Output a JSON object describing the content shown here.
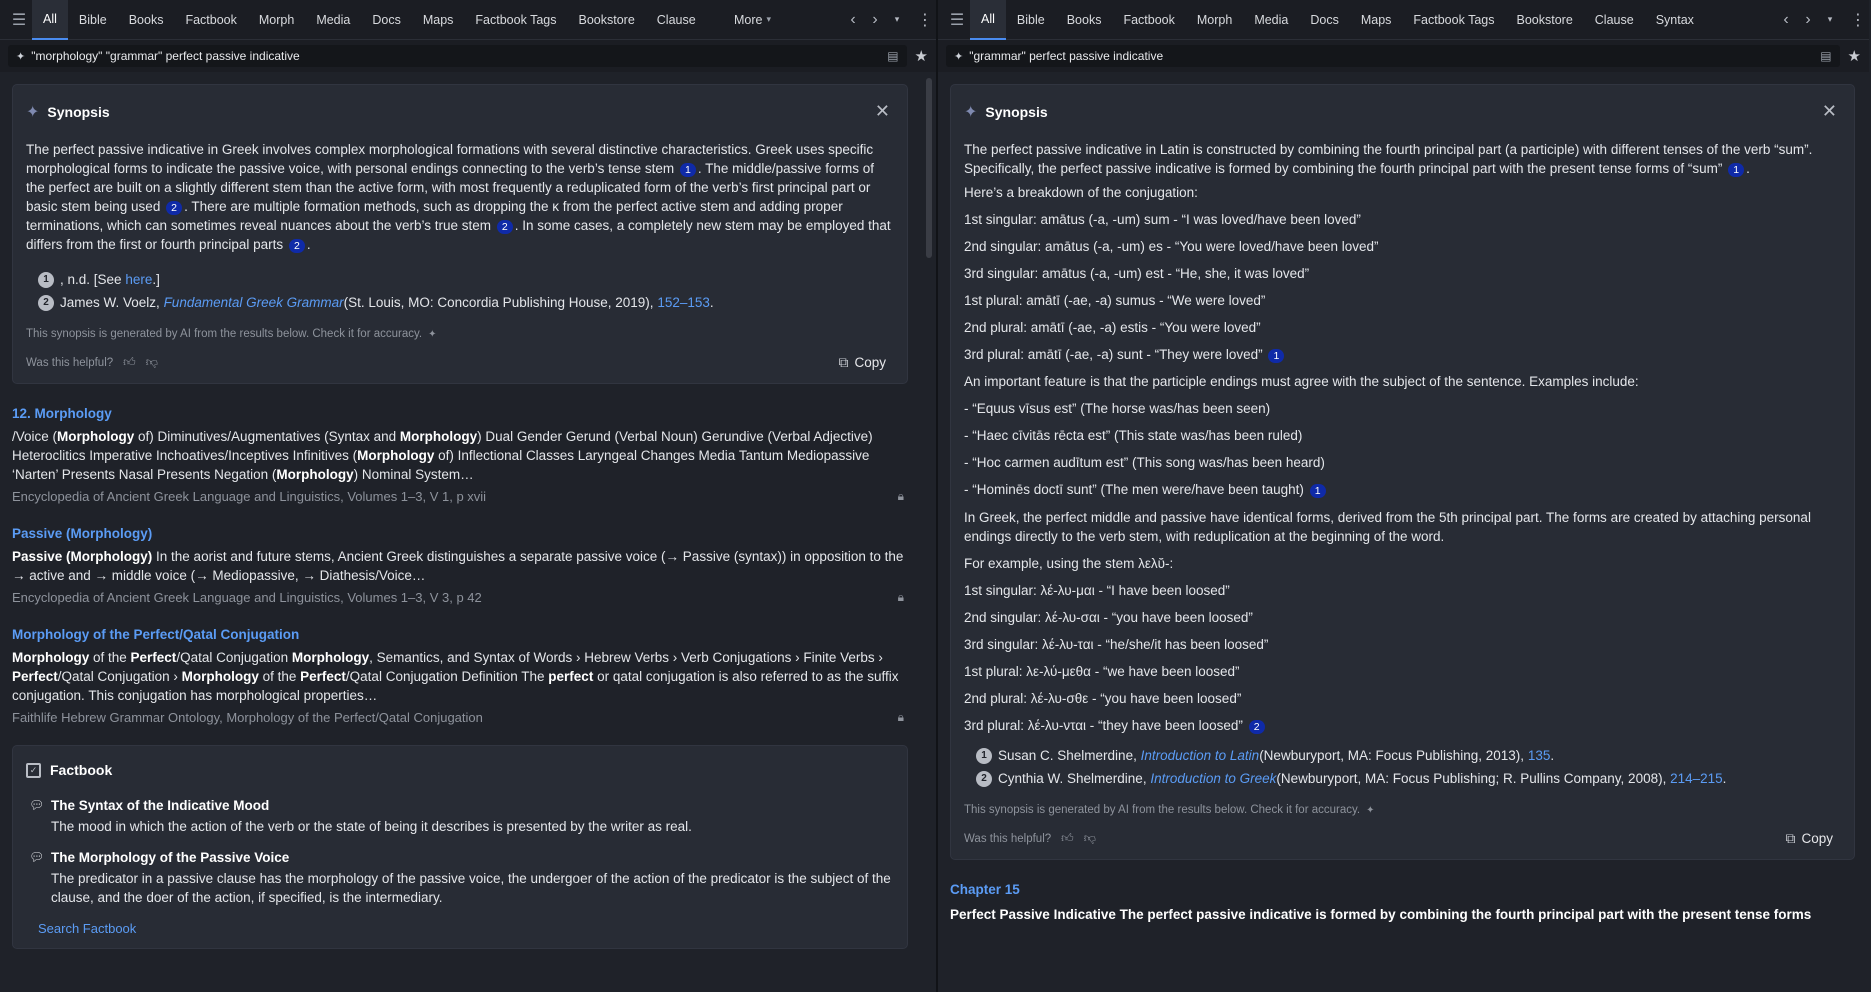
{
  "left": {
    "tabs": [
      "All",
      "Bible",
      "Books",
      "Factbook",
      "Morph",
      "Media",
      "Docs",
      "Maps",
      "Factbook Tags",
      "Bookstore",
      "Clause"
    ],
    "more_label": "More",
    "search_query": "\"morphology\" \"grammar\" perfect passive indicative",
    "synopsis": {
      "title": "Synopsis",
      "p1_a": "The perfect passive indicative in Greek involves complex morphological formations with several distinctive characteristics. Greek uses specific morphological forms to indicate the passive voice, with personal endings connecting to the verb’s tense stem",
      "p1_b": ". The middle/passive forms of the perfect are built on a slightly different stem than the active form, with most frequently a reduplicated form of the verb’s first principal part or basic stem being used",
      "p1_c": ". There are multiple formation methods, such as dropping the κ from the perfect active stem and adding proper terminations, which can sometimes reveal nuances about the verb’s true stem",
      "p1_d": ". In some cases, a completely new stem may be employed that differs from the first or fourth principal parts",
      "p1_e": ".",
      "cite1": "1",
      "cite2": "2",
      "foot1_num": "1",
      "foot1_pre": ", n.d. [See ",
      "foot1_link": "here",
      "foot1_post": ".]",
      "foot2_num": "2",
      "foot2_author": "James W. Voelz, ",
      "foot2_title": "Fundamental Greek Grammar",
      "foot2_pub": " (St. Louis, MO: Concordia Publishing House, 2019), ",
      "foot2_pages": "152–153",
      "foot2_end": ".",
      "disclaimer": "This synopsis is generated by AI from the results below. Check it for accuracy.",
      "helpful": "Was this helpful?",
      "copy": "Copy"
    },
    "results": [
      {
        "title": "12. Morphology",
        "body_html_parts": [
          "/Voice (",
          "Morphology",
          " of) Diminutives/Augmentatives (Syntax and ",
          "Morphology",
          ") Dual Gender Gerund (Verbal Noun) Gerundive (Verbal Adjective) Heteroclitics Imperative Inchoatives/Inceptives Infinitives (",
          "Morphology",
          " of) Inflectional Classes Laryngeal Changes Media Tantum Mediopassive ‘Narten’ Presents Nasal Presents Negation (",
          "Morphology",
          ") Nominal System…"
        ],
        "meta": "Encyclopedia of Ancient Greek Language and Linguistics, Volumes 1–3, V 1, p xvii"
      },
      {
        "title": "Passive (Morphology)",
        "body_html_parts": [
          "",
          "Passive (Morphology)",
          " In the aorist and future stems, Ancient Greek distinguishes a separate passive voice (→ Passive (syntax)) in opposition to the → active and → middle voice (→ Mediopassive, → Diathesis/Voice…"
        ],
        "meta": "Encyclopedia of Ancient Greek Language and Linguistics, Volumes 1–3, V 3, p 42"
      },
      {
        "title": "Morphology of the Perfect/Qatal Conjugation",
        "body_html_parts": [
          "",
          "Morphology",
          " of the ",
          "Perfect",
          "/Qatal Conjugation ",
          "Morphology",
          ", Semantics, and Syntax of Words › Hebrew Verbs › Verb Conjugations › Finite Verbs › ",
          "Perfect",
          "/Qatal Conjugation › ",
          "Morphology",
          " of the ",
          "Perfect",
          "/Qatal Conjugation Definition The ",
          "perfect",
          " or qatal conjugation is also referred to as the suffix conjugation. This conjugation has morphological properties…"
        ],
        "meta": "Faithlife Hebrew Grammar Ontology, Morphology of the Perfect/Qatal Conjugation"
      }
    ],
    "factbook": {
      "title": "Factbook",
      "items": [
        {
          "title": "The Syntax of the Indicative Mood",
          "desc": "The mood in which the action of the verb or the state of being it describes is presented by the writer as real."
        },
        {
          "title": "The Morphology of the Passive Voice",
          "desc": "The predicator in a passive clause has the morphology of the passive voice, the undergoer of the action of the predicator is the subject of the clause, and the doer of the action, if specified, is the intermediary."
        }
      ],
      "more_link": "Search Factbook"
    }
  },
  "right": {
    "tabs": [
      "All",
      "Bible",
      "Books",
      "Factbook",
      "Morph",
      "Media",
      "Docs",
      "Maps",
      "Factbook Tags",
      "Bookstore",
      "Clause",
      "Syntax"
    ],
    "search_query": "\"grammar\" perfect passive indicative",
    "synopsis": {
      "title": "Synopsis",
      "intro": "The perfect passive indicative in Latin is constructed by combining the fourth principal part (a participle) with different tenses of the verb “sum”. Specifically, the perfect passive indicative is formed by combining the fourth principal part with the present tense forms of “sum”",
      "intro_end": ".",
      "breakdown": "Here’s a breakdown of the conjugation:",
      "latin": [
        "1st singular: amātus (-a, -um) sum - “I was loved/have been loved”",
        "2nd singular: amātus (-a, -um) es - “You were loved/have been loved”",
        "3rd singular: amātus (-a, -um) est - “He, she, it was loved”",
        "1st plural: amātī (-ae, -a) sumus - “We were loved”",
        "2nd plural: amātī (-ae, -a) estis - “You were loved”",
        "3rd plural: amātī (-ae, -a) sunt - “They were loved”"
      ],
      "feature": "An important feature is that the participle endings must agree with the subject of the sentence. Examples include:",
      "examples": [
        "- “Equus vīsus est” (The horse was/has been seen)",
        "- “Haec cīvitās rēcta est” (This state was/has been ruled)",
        "- “Hoc carmen audītum est” (This song was/has been heard)",
        "- “Hominēs doctī sunt” (The men were/have been taught)"
      ],
      "greek_intro": "In Greek, the perfect middle and passive have identical forms, derived from the 5th principal part. The forms are created by attaching personal endings directly to the verb stem, with reduplication at the beginning of the word.",
      "stem_line": "For example, using the stem λελῠ-:",
      "greek": [
        "1st singular: λέ-λυ-μαι - “I have been loosed”",
        "2nd singular: λέ-λυ-σαι - “you have been loosed”",
        "3rd singular: λέ-λυ-ται - “he/she/it has been loosed”",
        "1st plural: λε-λύ-μεθα - “we have been loosed”",
        "2nd plural: λέ-λυ-σθε - “you have been loosed”",
        "3rd plural: λέ-λυ-νται - “they have been loosed”"
      ],
      "cite1": "1",
      "cite2": "2",
      "foot1_num": "1",
      "foot1_author": "Susan C. Shelmerdine, ",
      "foot1_title": "Introduction to Latin",
      "foot1_pub": " (Newburyport, MA: Focus Publishing, 2013), ",
      "foot1_pages": "135",
      "foot1_end": ".",
      "foot2_num": "2",
      "foot2_author": "Cynthia W. Shelmerdine, ",
      "foot2_title": "Introduction to Greek",
      "foot2_pub": " (Newburyport, MA: Focus Publishing; R. Pullins Company, 2008), ",
      "foot2_pages": "214–215",
      "foot2_end": ".",
      "disclaimer": "This synopsis is generated by AI from the results below. Check it for accuracy.",
      "helpful": "Was this helpful?",
      "copy": "Copy"
    },
    "chapter": {
      "title": "Chapter 15",
      "body": "Perfect Passive Indicative The perfect passive indicative is formed by combining the fourth principal part with the present tense forms"
    }
  }
}
